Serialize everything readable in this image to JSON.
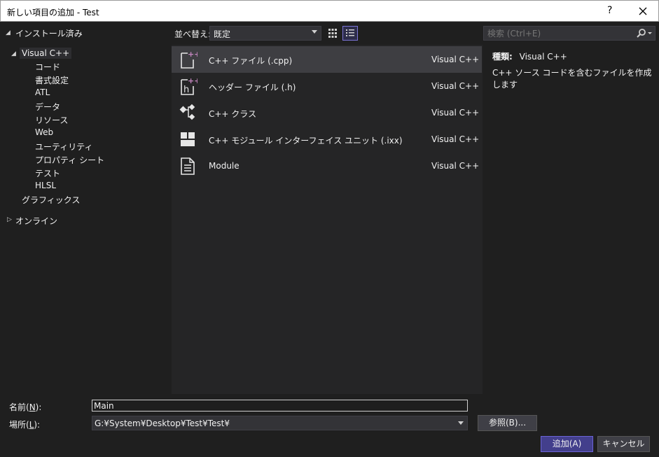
{
  "window": {
    "title": "新しい項目の追加 - Test",
    "help_label": "?"
  },
  "tree": {
    "installed": "インストール済み",
    "visual_cpp": "Visual C++",
    "children": [
      "コード",
      "書式設定",
      "ATL",
      "データ",
      "リソース",
      "Web",
      "ユーティリティ",
      "プロパティ シート",
      "テスト",
      "HLSL"
    ],
    "graphics": "グラフィックス",
    "online": "オンライン"
  },
  "toolbar": {
    "sort_label": "並べ替え:",
    "sort_value": "既定"
  },
  "templates": [
    {
      "name": "C++ ファイル (.cpp)",
      "lang": "Visual C++",
      "icon": "cpp-file-icon"
    },
    {
      "name": "ヘッダー ファイル (.h)",
      "lang": "Visual C++",
      "icon": "header-file-icon"
    },
    {
      "name": "C++ クラス",
      "lang": "Visual C++",
      "icon": "class-icon"
    },
    {
      "name": "C++ モジュール インターフェイス ユニット (.ixx)",
      "lang": "Visual C++",
      "icon": "module-interface-icon"
    },
    {
      "name": "Module",
      "lang": "Visual C++",
      "icon": "module-document-icon"
    }
  ],
  "search": {
    "placeholder": "検索 (Ctrl+E)"
  },
  "details": {
    "kind_label": "種類:",
    "kind_value": "Visual C++",
    "description": "C++ ソース コードを含むファイルを作成します"
  },
  "form": {
    "name_label_pre": "名前(",
    "name_label_key": "N",
    "name_label_post": "):",
    "name_value": "Main",
    "location_label_pre": "場所(",
    "location_label_key": "L",
    "location_label_post": "):",
    "location_value": "G:¥System¥Desktop¥Test¥Test¥",
    "browse_label": "参照(B)...",
    "add_label": "追加(A)",
    "cancel_label": "キャンセル"
  },
  "colors": {
    "accent": "#7b74d6",
    "background": "#1f1f1f",
    "list_background": "#252526"
  }
}
